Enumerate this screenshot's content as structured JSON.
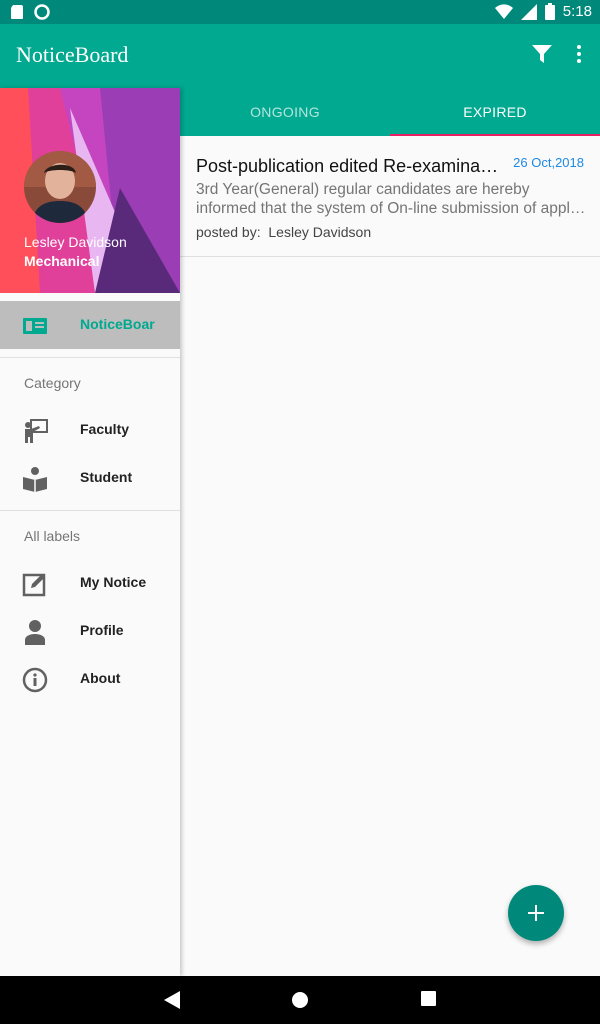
{
  "status_bar": {
    "time": "5:18"
  },
  "app_bar": {
    "title": "NoticeBoard",
    "filter_icon": "filter-icon",
    "more_icon": "more-vert-icon"
  },
  "tabs": [
    {
      "label": "ONGOING",
      "active": false
    },
    {
      "label": "EXPIRED",
      "active": true
    }
  ],
  "notices": [
    {
      "title": "Post-publication  edited Re-examination result",
      "date": "26 Oct,2018",
      "body_line1": "3rd Year(General) regular  candidates are hereby",
      "body_line2": "informed that the system of   On-line submission of applications",
      "posted_by_label": "posted by:",
      "posted_by": "Lesley Davidson"
    }
  ],
  "drawer": {
    "user_name": "Lesley Davidson",
    "department": "Mechanical",
    "main_item": {
      "label": "NoticeBoar",
      "icon": "noticeboard-icon"
    },
    "category_header": "Category",
    "category_items": [
      {
        "label": "Faculty",
        "icon": "faculty-icon"
      },
      {
        "label": "Student",
        "icon": "student-icon"
      }
    ],
    "labels_header": "All labels",
    "label_items": [
      {
        "label": "My Notice",
        "icon": "edit-icon"
      },
      {
        "label": "Profile",
        "icon": "person-icon"
      },
      {
        "label": "About",
        "icon": "info-icon"
      }
    ]
  },
  "fab": {
    "icon": "add-icon"
  },
  "colors": {
    "primary": "#00a98f",
    "primary_dark": "#00897b",
    "accent": "#e91e63",
    "date": "#1e88e5"
  }
}
